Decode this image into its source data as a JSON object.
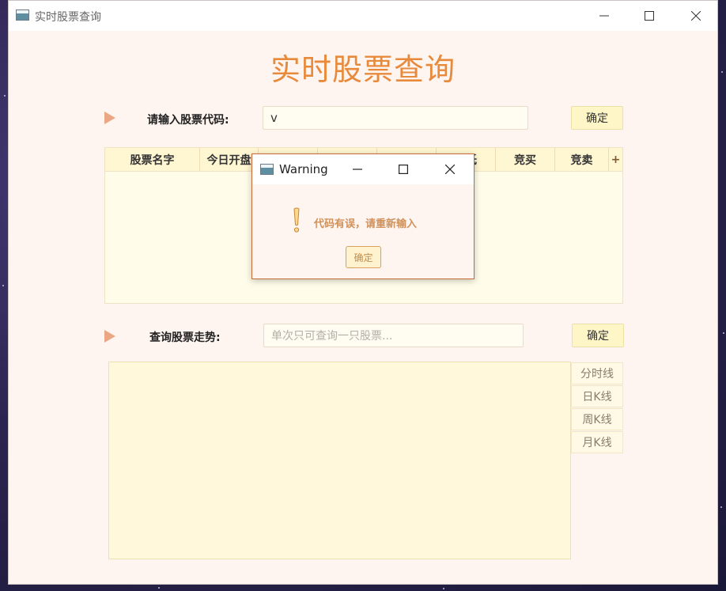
{
  "window": {
    "title": "实时股票查询",
    "controls": {
      "minimize_icon": "minimize-icon",
      "maximize_icon": "maximize-icon",
      "close_icon": "close-icon"
    }
  },
  "heading": "实时股票查询",
  "query": {
    "label": "请输入股票代码:",
    "value": "v",
    "confirm_label": "确定"
  },
  "table": {
    "columns": [
      "股票名字",
      "今日开盘",
      "",
      "",
      "",
      "最低",
      "竞买",
      "竞卖"
    ],
    "add_column_label": "+",
    "rows": []
  },
  "trend": {
    "label": "查询股票走势:",
    "placeholder": "单次只可查询一只股票...",
    "value": "",
    "confirm_label": "确定",
    "buttons": [
      "分时线",
      "日K线",
      "周K线",
      "月K线"
    ]
  },
  "dialog": {
    "title": "Warning",
    "message": "代码有误，请重新输入",
    "ok_label": "确定",
    "icon": "exclamation-icon"
  },
  "colors": {
    "accent": "#e88a3c",
    "window_bg": "#fff5f0",
    "button_bg": "#fff6c7",
    "table_bg": "#fffde9",
    "dialog_border": "#c96a3b"
  }
}
